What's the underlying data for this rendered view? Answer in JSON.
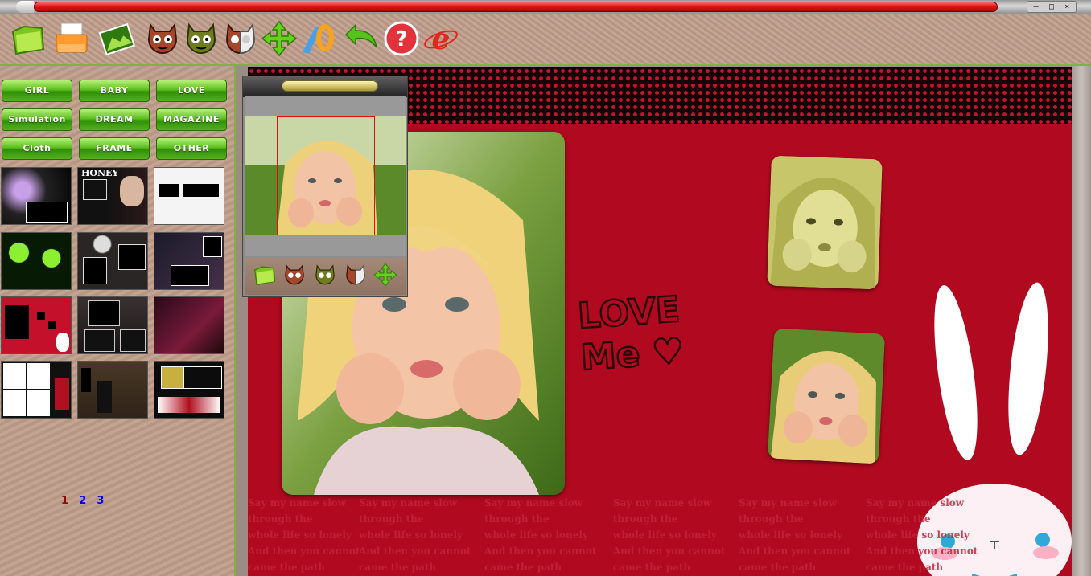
{
  "titlebar": {
    "controls": [
      "–",
      "□",
      "×"
    ]
  },
  "toolbar": {
    "icons": [
      "open-folder-icon",
      "print-icon",
      "photo-icon",
      "mask-red-icon",
      "mask-green-icon",
      "mask-half-icon",
      "move-arrows-icon",
      "text-color-icon",
      "undo-icon",
      "help-icon",
      "browser-icon"
    ]
  },
  "categories": [
    "GIRL",
    "BABY",
    "LOVE",
    "Simulation",
    "DREAM",
    "MAGAZINE",
    "Cloth",
    "FRAME",
    "OTHER"
  ],
  "thumbnails": [
    {
      "text": ""
    },
    {
      "text": "HONEY"
    },
    {
      "text": ""
    },
    {
      "text": ""
    },
    {
      "text": ""
    },
    {
      "text": ""
    },
    {
      "text": ""
    },
    {
      "text": ""
    },
    {
      "text": ""
    },
    {
      "text": ""
    },
    {
      "text": ""
    },
    {
      "text": ""
    }
  ],
  "pager": {
    "current": "1",
    "pages": [
      "2",
      "3"
    ]
  },
  "design": {
    "love_line1": "LOVE",
    "love_line2": "Me ♥",
    "poem_columns": [
      "Say my name slow\nthrough the\nwhole life so lonely\nAnd then you cannot\ncame the path",
      "Say my name slow\nthrough the\nwhole life so lonely\nAnd then you cannot\ncame the path",
      "Say my name slow\nthrough the\nwhole life so lonely\nAnd then you cannot\ncame the path",
      "Say my name slow\nthrough the\nwhole life so lonely\nAnd then you cannot\ncame the path",
      "Say my name slow\nthrough the\nwhole life so lonely\nAnd then you cannot\ncame the path",
      "Say my name slow\nthrough the\nwhole life so lonely\nAnd then you cannot\ncame the path"
    ]
  },
  "navigator": {
    "icons": [
      "open-folder-icon",
      "mask-red-icon",
      "mask-green-icon",
      "mask-half-icon",
      "move-arrows-icon"
    ]
  }
}
